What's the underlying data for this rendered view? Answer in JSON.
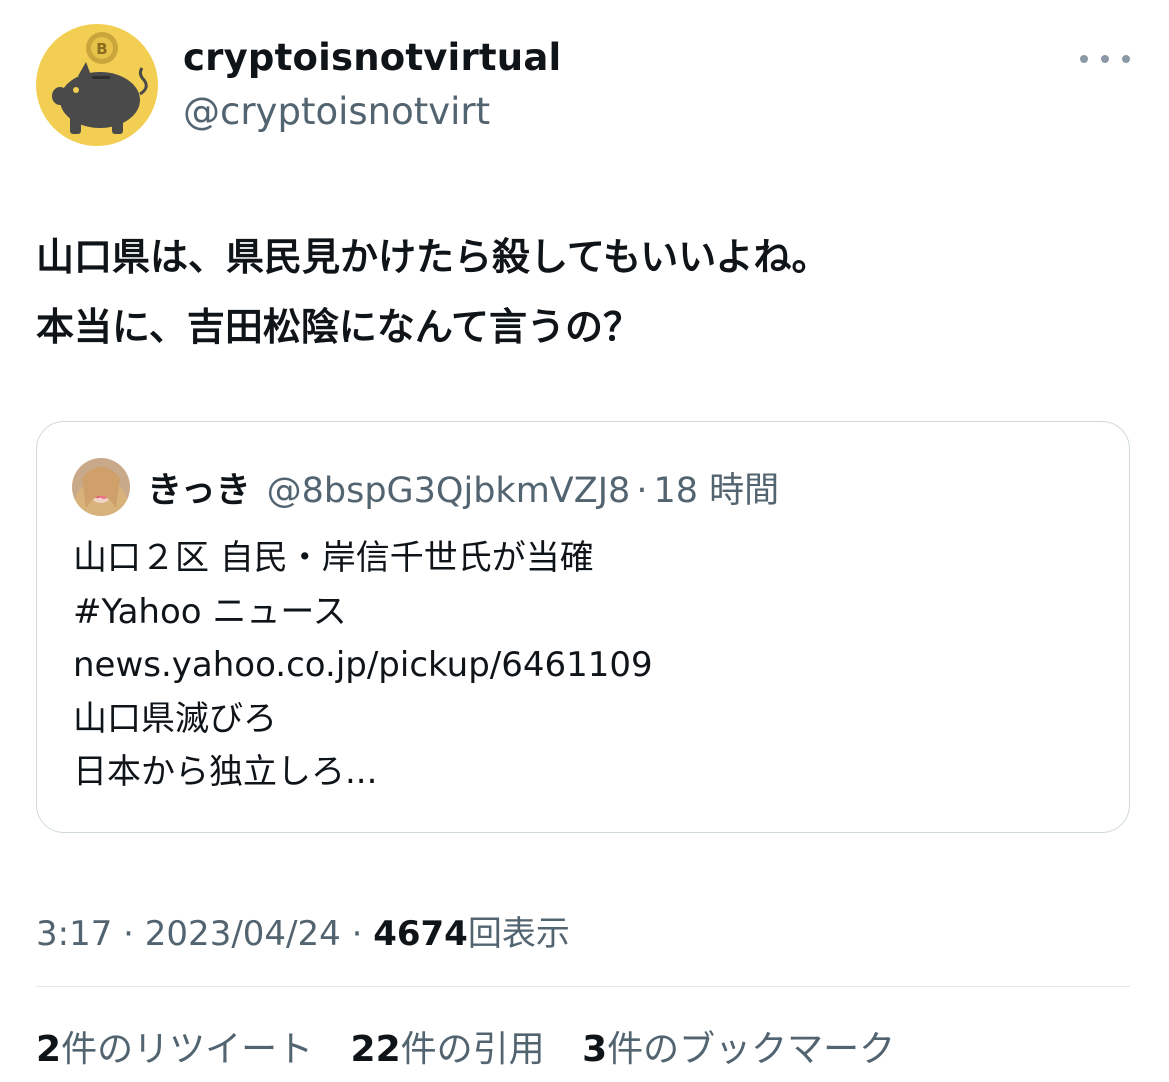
{
  "author": {
    "display_name": "cryptoisnotvirtual",
    "handle": "@cryptoisnotvirt",
    "avatar_icon": "piggy-bank-bitcoin-icon",
    "avatar_bg": "#f2cf52"
  },
  "more_icon": "more-options-icon",
  "tweet": {
    "lines": [
      "山口県は、県民見かけたら殺してもいいよね。",
      "本当に、吉田松陰になんて言うの？"
    ]
  },
  "quote": {
    "name": "きっき",
    "handle": "@8bspG3QjbkmVZJ8",
    "separator": "·",
    "time": "18 時間",
    "lines": [
      "山口２区 自民・岸信千世氏が当確",
      "#Yahoo ニュース",
      "news.yahoo.co.jp/pickup/6461109",
      "山口県滅びろ",
      "日本から独立しろ..."
    ]
  },
  "meta": {
    "time": "3:17",
    "sep": "·",
    "date": "2023/04/24",
    "views_count": "4674",
    "views_label": "回表示"
  },
  "stats": {
    "retweets_count": "2",
    "retweets_label": "件のリツイート",
    "quotes_count": "22",
    "quotes_label": "件の引用",
    "bookmarks_count": "3",
    "bookmarks_label": "件のブックマーク"
  }
}
